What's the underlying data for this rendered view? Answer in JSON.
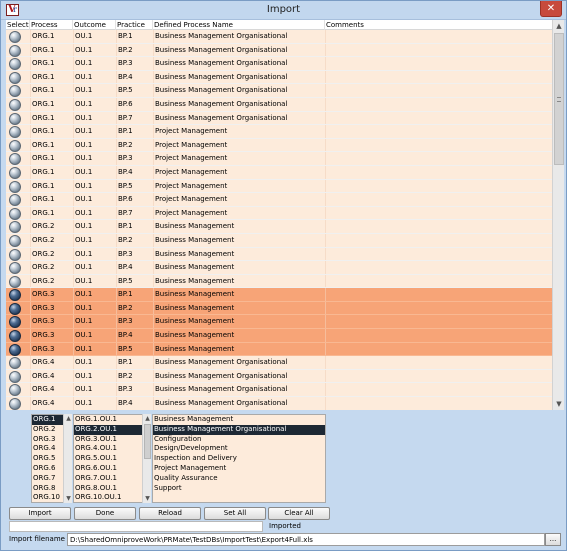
{
  "window": {
    "title": "Import",
    "close_glyph": "✕",
    "app_icon": "vr-logo-icon",
    "app_icon_letters": [
      "V",
      "r"
    ]
  },
  "table": {
    "headers": [
      "Select",
      "Process",
      "Outcome",
      "Practice",
      "Defined Process Name",
      "Comments"
    ],
    "rows": [
      {
        "process": "ORG.1",
        "outcome": "OU.1",
        "practice": "BP.1",
        "name": "Business Management Organisational",
        "selected": false
      },
      {
        "process": "ORG.1",
        "outcome": "OU.1",
        "practice": "BP.2",
        "name": "Business Management Organisational",
        "selected": false
      },
      {
        "process": "ORG.1",
        "outcome": "OU.1",
        "practice": "BP.3",
        "name": "Business Management Organisational",
        "selected": false
      },
      {
        "process": "ORG.1",
        "outcome": "OU.1",
        "practice": "BP.4",
        "name": "Business Management Organisational",
        "selected": false
      },
      {
        "process": "ORG.1",
        "outcome": "OU.1",
        "practice": "BP.5",
        "name": "Business Management Organisational",
        "selected": false
      },
      {
        "process": "ORG.1",
        "outcome": "OU.1",
        "practice": "BP.6",
        "name": "Business Management Organisational",
        "selected": false
      },
      {
        "process": "ORG.1",
        "outcome": "OU.1",
        "practice": "BP.7",
        "name": "Business Management Organisational",
        "selected": false
      },
      {
        "process": "ORG.1",
        "outcome": "OU.1",
        "practice": "BP.1",
        "name": "Project Management",
        "selected": false
      },
      {
        "process": "ORG.1",
        "outcome": "OU.1",
        "practice": "BP.2",
        "name": "Project Management",
        "selected": false
      },
      {
        "process": "ORG.1",
        "outcome": "OU.1",
        "practice": "BP.3",
        "name": "Project Management",
        "selected": false
      },
      {
        "process": "ORG.1",
        "outcome": "OU.1",
        "practice": "BP.4",
        "name": "Project Management",
        "selected": false
      },
      {
        "process": "ORG.1",
        "outcome": "OU.1",
        "practice": "BP.5",
        "name": "Project Management",
        "selected": false
      },
      {
        "process": "ORG.1",
        "outcome": "OU.1",
        "practice": "BP.6",
        "name": "Project Management",
        "selected": false
      },
      {
        "process": "ORG.1",
        "outcome": "OU.1",
        "practice": "BP.7",
        "name": "Project Management",
        "selected": false
      },
      {
        "process": "ORG.2",
        "outcome": "OU.1",
        "practice": "BP.1",
        "name": "Business Management",
        "selected": false
      },
      {
        "process": "ORG.2",
        "outcome": "OU.1",
        "practice": "BP.2",
        "name": "Business Management",
        "selected": false
      },
      {
        "process": "ORG.2",
        "outcome": "OU.1",
        "practice": "BP.3",
        "name": "Business Management",
        "selected": false
      },
      {
        "process": "ORG.2",
        "outcome": "OU.1",
        "practice": "BP.4",
        "name": "Business Management",
        "selected": false
      },
      {
        "process": "ORG.2",
        "outcome": "OU.1",
        "practice": "BP.5",
        "name": "Business Management",
        "selected": false
      },
      {
        "process": "ORG.3",
        "outcome": "OU.1",
        "practice": "BP.1",
        "name": "Business Management",
        "selected": true
      },
      {
        "process": "ORG.3",
        "outcome": "OU.1",
        "practice": "BP.2",
        "name": "Business Management",
        "selected": true
      },
      {
        "process": "ORG.3",
        "outcome": "OU.1",
        "practice": "BP.3",
        "name": "Business Management",
        "selected": true
      },
      {
        "process": "ORG.3",
        "outcome": "OU.1",
        "practice": "BP.4",
        "name": "Business Management",
        "selected": true
      },
      {
        "process": "ORG.3",
        "outcome": "OU.1",
        "practice": "BP.5",
        "name": "Business Management",
        "selected": true
      },
      {
        "process": "ORG.4",
        "outcome": "OU.1",
        "practice": "BP.1",
        "name": "Business Management Organisational",
        "selected": false
      },
      {
        "process": "ORG.4",
        "outcome": "OU.1",
        "practice": "BP.2",
        "name": "Business Management Organisational",
        "selected": false
      },
      {
        "process": "ORG.4",
        "outcome": "OU.1",
        "practice": "BP.3",
        "name": "Business Management Organisational",
        "selected": false
      },
      {
        "process": "ORG.4",
        "outcome": "OU.1",
        "practice": "BP.4",
        "name": "Business Management Organisational",
        "selected": false
      }
    ]
  },
  "picker": {
    "processes": [
      "ORG.1",
      "ORG.2",
      "ORG.3",
      "ORG.4",
      "ORG.5",
      "ORG.6",
      "ORG.7",
      "ORG.8",
      "ORG.10"
    ],
    "selected_process": "ORG.1",
    "outcomes": [
      "ORG.1.OU.1",
      "ORG.2.OU.1",
      "ORG.3.OU.1",
      "ORG.4.OU.1",
      "ORG.5.OU.1",
      "ORG.6.OU.1",
      "ORG.7.OU.1",
      "ORG.8.OU.1",
      "ORG.10.OU.1"
    ],
    "selected_outcome": "ORG.2.OU.1",
    "defined_processes": [
      "Business Management",
      "Business Management Organisational",
      "Configuration",
      "Design/Development",
      "Inspection and Delivery",
      "Project Management",
      "Quality Assurance",
      "Support"
    ],
    "selected_defined_process": "Business Management Organisational"
  },
  "buttons": {
    "import": "Import",
    "done": "Done",
    "reload": "Reload",
    "set_all": "Set All",
    "clear_all": "Clear All",
    "browse": "..."
  },
  "status": "Imported",
  "file": {
    "label": "Import filename",
    "value": "D:\\SharedOmniproveWork\\PRMate\\TestDBs\\ImportTest\\Export4Full.xls"
  },
  "colors": {
    "row_bg": "#fdebdb",
    "row_selected_bg": "#f7a477",
    "list_selection": "#1d2834",
    "window_bg": "#c5d9ef"
  }
}
